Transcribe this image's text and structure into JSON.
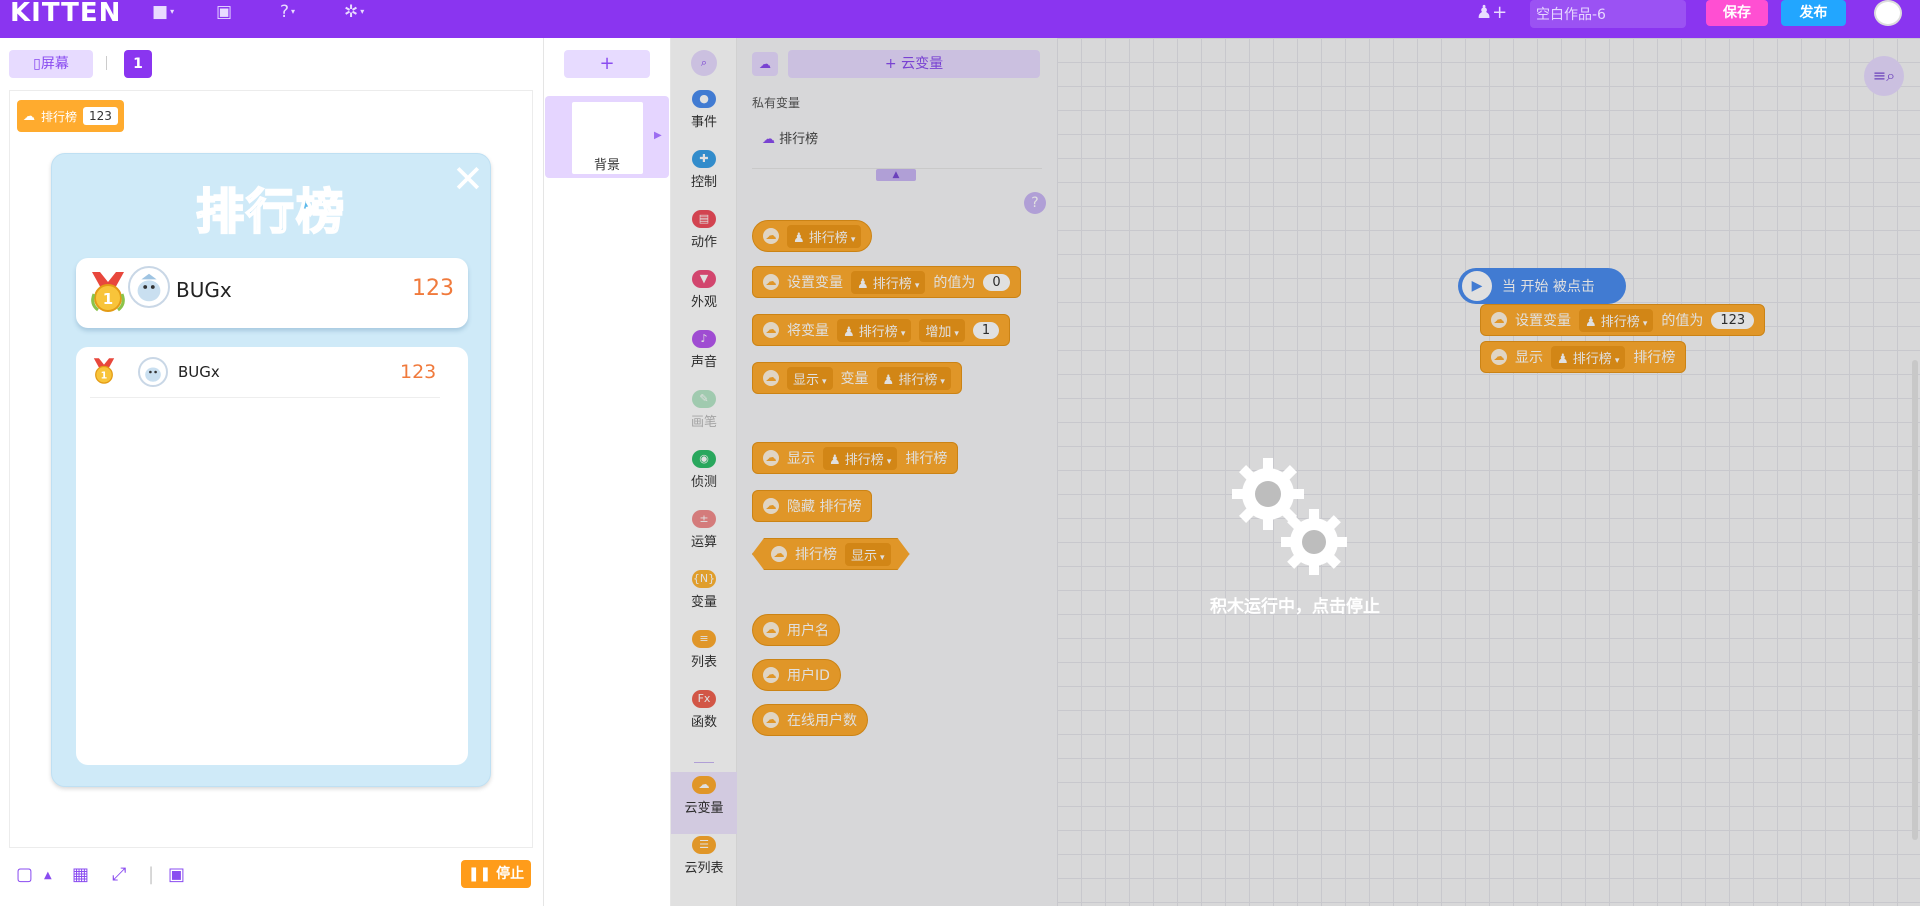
{
  "topbar": {
    "logo": "KITTEN",
    "project_title": "空白作品-6",
    "save_label": "保存",
    "publish_label": "发布"
  },
  "stage": {
    "screen_label": "屏幕",
    "page_number": "1",
    "monitor": {
      "name": "排行榜",
      "value": "123"
    },
    "leaderboard": {
      "title": "排行榜",
      "top_entry": {
        "rank": "1",
        "name": "BUGx",
        "score": "123"
      },
      "rows": [
        {
          "rank": "1",
          "name": "BUGx",
          "score": "123"
        }
      ]
    },
    "stop_label": "停止"
  },
  "sprites": {
    "add_label": "+",
    "background_label": "背景"
  },
  "categories": [
    {
      "label": "事件",
      "color": "#4a8cf0",
      "icon": "toggle-icon"
    },
    {
      "label": "控制",
      "color": "#3aa0e8",
      "icon": "gamepad-icon"
    },
    {
      "label": "动作",
      "color": "#ef4d5c",
      "icon": "motion-icon"
    },
    {
      "label": "外观",
      "color": "#f0507e",
      "icon": "shirt-icon"
    },
    {
      "label": "声音",
      "color": "#b657f0",
      "icon": "music-icon"
    },
    {
      "label": "画笔",
      "color": "#b7e6c8",
      "icon": "pen-icon"
    },
    {
      "label": "侦测",
      "color": "#2fbf6a",
      "icon": "sensor-icon"
    },
    {
      "label": "运算",
      "color": "#f28d8d",
      "icon": "math-icon"
    },
    {
      "label": "变量",
      "color": "#ffb433",
      "icon": "variable-icon"
    },
    {
      "label": "列表",
      "color": "#ffab2e",
      "icon": "list-icon"
    },
    {
      "label": "函数",
      "color": "#f06250",
      "icon": "function-icon"
    },
    {
      "label": "云变量",
      "color": "#ffab2e",
      "icon": "cloud-icon"
    },
    {
      "label": "云列表",
      "color": "#ffab2e",
      "icon": "cloud-list-icon"
    }
  ],
  "palette": {
    "cloud_var_button": "+ 云变量",
    "private_vars_label": "私有变量",
    "private_var_name": "排行榜",
    "blocks": {
      "reporter_var": "排行榜",
      "set_label": "设置变量",
      "set_var": "排行榜",
      "set_suffix": "的值为",
      "set_value": "0",
      "change_label": "将变量",
      "change_var": "排行榜",
      "change_op": "增加",
      "change_value": "1",
      "show_dd": "显示",
      "show_var_label": "变量",
      "show_var": "排行榜",
      "show2_label": "显示",
      "show2_var": "排行榜",
      "show2_suffix": "排行榜",
      "hide_label": "隐藏 排行榜",
      "bool_label": "排行榜",
      "bool_dd": "显示",
      "username": "用户名",
      "userid": "用户ID",
      "online": "在线用户数"
    }
  },
  "workspace": {
    "hat_label": "当 开始 被点击",
    "set_label": "设置变量",
    "set_var": "排行榜",
    "set_suffix": "的值为",
    "set_value": "123",
    "show_label": "显示",
    "show_var": "排行榜",
    "show_suffix": "排行榜",
    "running_text": "积木运行中，点击停止"
  }
}
